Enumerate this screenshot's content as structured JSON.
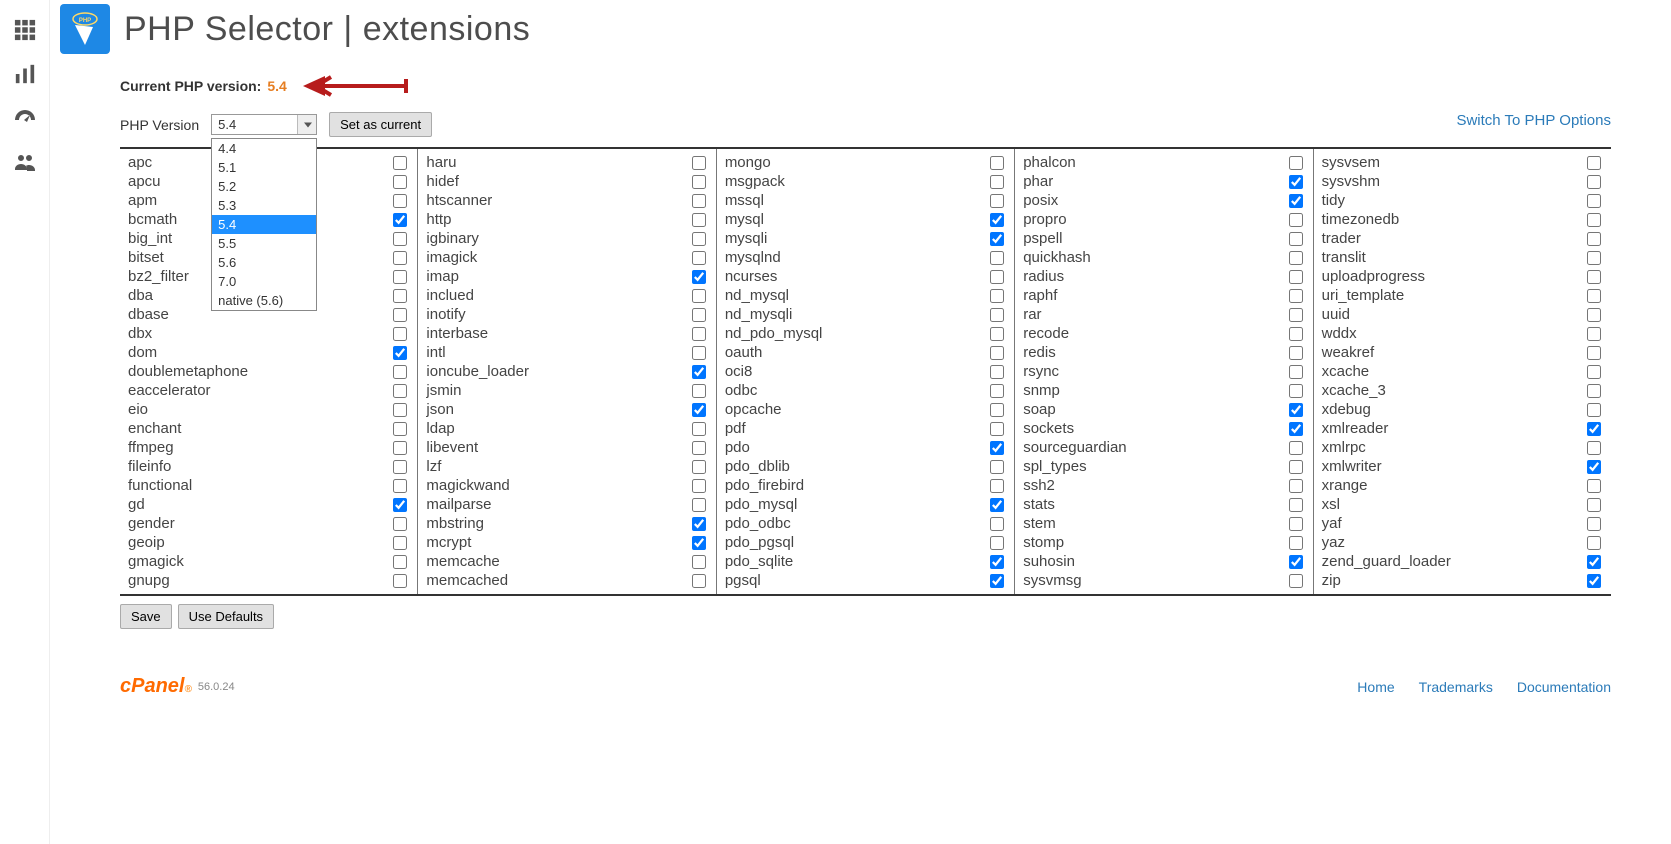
{
  "page_title": "PHP Selector | extensions",
  "current_label": "Current PHP version:",
  "current_version": "5.4",
  "version_label": "PHP Version",
  "selected_version": "5.4",
  "set_current_btn": "Set as current",
  "switch_link": "Switch To PHP Options",
  "version_options": [
    "4.4",
    "5.1",
    "5.2",
    "5.3",
    "5.4",
    "5.5",
    "5.6",
    "7.0",
    "native (5.6)"
  ],
  "save_btn": "Save",
  "defaults_btn": "Use Defaults",
  "footer": {
    "brand": "cPanel",
    "version": "56.0.24",
    "links": [
      "Home",
      "Trademarks",
      "Documentation"
    ]
  },
  "columns": [
    [
      {
        "name": "apc",
        "checked": false
      },
      {
        "name": "apcu",
        "checked": false
      },
      {
        "name": "apm",
        "checked": false
      },
      {
        "name": "bcmath",
        "checked": true
      },
      {
        "name": "big_int",
        "checked": false
      },
      {
        "name": "bitset",
        "checked": false
      },
      {
        "name": "bz2_filter",
        "checked": false
      },
      {
        "name": "dba",
        "checked": false
      },
      {
        "name": "dbase",
        "checked": false
      },
      {
        "name": "dbx",
        "checked": false
      },
      {
        "name": "dom",
        "checked": true
      },
      {
        "name": "doublemetaphone",
        "checked": false
      },
      {
        "name": "eaccelerator",
        "checked": false
      },
      {
        "name": "eio",
        "checked": false
      },
      {
        "name": "enchant",
        "checked": false
      },
      {
        "name": "ffmpeg",
        "checked": false
      },
      {
        "name": "fileinfo",
        "checked": false
      },
      {
        "name": "functional",
        "checked": false
      },
      {
        "name": "gd",
        "checked": true
      },
      {
        "name": "gender",
        "checked": false
      },
      {
        "name": "geoip",
        "checked": false
      },
      {
        "name": "gmagick",
        "checked": false
      },
      {
        "name": "gnupg",
        "checked": false
      }
    ],
    [
      {
        "name": "haru",
        "checked": false
      },
      {
        "name": "hidef",
        "checked": false
      },
      {
        "name": "htscanner",
        "checked": false
      },
      {
        "name": "http",
        "checked": false
      },
      {
        "name": "igbinary",
        "checked": false
      },
      {
        "name": "imagick",
        "checked": false
      },
      {
        "name": "imap",
        "checked": true
      },
      {
        "name": "inclued",
        "checked": false
      },
      {
        "name": "inotify",
        "checked": false
      },
      {
        "name": "interbase",
        "checked": false
      },
      {
        "name": "intl",
        "checked": false
      },
      {
        "name": "ioncube_loader",
        "checked": true
      },
      {
        "name": "jsmin",
        "checked": false
      },
      {
        "name": "json",
        "checked": true
      },
      {
        "name": "ldap",
        "checked": false
      },
      {
        "name": "libevent",
        "checked": false
      },
      {
        "name": "lzf",
        "checked": false
      },
      {
        "name": "magickwand",
        "checked": false
      },
      {
        "name": "mailparse",
        "checked": false
      },
      {
        "name": "mbstring",
        "checked": true
      },
      {
        "name": "mcrypt",
        "checked": true
      },
      {
        "name": "memcache",
        "checked": false
      },
      {
        "name": "memcached",
        "checked": false
      }
    ],
    [
      {
        "name": "mongo",
        "checked": false
      },
      {
        "name": "msgpack",
        "checked": false
      },
      {
        "name": "mssql",
        "checked": false
      },
      {
        "name": "mysql",
        "checked": true
      },
      {
        "name": "mysqli",
        "checked": true
      },
      {
        "name": "mysqlnd",
        "checked": false
      },
      {
        "name": "ncurses",
        "checked": false
      },
      {
        "name": "nd_mysql",
        "checked": false
      },
      {
        "name": "nd_mysqli",
        "checked": false
      },
      {
        "name": "nd_pdo_mysql",
        "checked": false
      },
      {
        "name": "oauth",
        "checked": false
      },
      {
        "name": "oci8",
        "checked": false
      },
      {
        "name": "odbc",
        "checked": false
      },
      {
        "name": "opcache",
        "checked": false
      },
      {
        "name": "pdf",
        "checked": false
      },
      {
        "name": "pdo",
        "checked": true
      },
      {
        "name": "pdo_dblib",
        "checked": false
      },
      {
        "name": "pdo_firebird",
        "checked": false
      },
      {
        "name": "pdo_mysql",
        "checked": true
      },
      {
        "name": "pdo_odbc",
        "checked": false
      },
      {
        "name": "pdo_pgsql",
        "checked": false
      },
      {
        "name": "pdo_sqlite",
        "checked": true
      },
      {
        "name": "pgsql",
        "checked": true
      }
    ],
    [
      {
        "name": "phalcon",
        "checked": false
      },
      {
        "name": "phar",
        "checked": true
      },
      {
        "name": "posix",
        "checked": true
      },
      {
        "name": "propro",
        "checked": false
      },
      {
        "name": "pspell",
        "checked": false
      },
      {
        "name": "quickhash",
        "checked": false
      },
      {
        "name": "radius",
        "checked": false
      },
      {
        "name": "raphf",
        "checked": false
      },
      {
        "name": "rar",
        "checked": false
      },
      {
        "name": "recode",
        "checked": false
      },
      {
        "name": "redis",
        "checked": false
      },
      {
        "name": "rsync",
        "checked": false
      },
      {
        "name": "snmp",
        "checked": false
      },
      {
        "name": "soap",
        "checked": true
      },
      {
        "name": "sockets",
        "checked": true
      },
      {
        "name": "sourceguardian",
        "checked": false
      },
      {
        "name": "spl_types",
        "checked": false
      },
      {
        "name": "ssh2",
        "checked": false
      },
      {
        "name": "stats",
        "checked": false
      },
      {
        "name": "stem",
        "checked": false
      },
      {
        "name": "stomp",
        "checked": false
      },
      {
        "name": "suhosin",
        "checked": true
      },
      {
        "name": "sysvmsg",
        "checked": false
      }
    ],
    [
      {
        "name": "sysvsem",
        "checked": false
      },
      {
        "name": "sysvshm",
        "checked": false
      },
      {
        "name": "tidy",
        "checked": false
      },
      {
        "name": "timezonedb",
        "checked": false
      },
      {
        "name": "trader",
        "checked": false
      },
      {
        "name": "translit",
        "checked": false
      },
      {
        "name": "uploadprogress",
        "checked": false
      },
      {
        "name": "uri_template",
        "checked": false
      },
      {
        "name": "uuid",
        "checked": false
      },
      {
        "name": "wddx",
        "checked": false
      },
      {
        "name": "weakref",
        "checked": false
      },
      {
        "name": "xcache",
        "checked": false
      },
      {
        "name": "xcache_3",
        "checked": false
      },
      {
        "name": "xdebug",
        "checked": false
      },
      {
        "name": "xmlreader",
        "checked": true
      },
      {
        "name": "xmlrpc",
        "checked": false
      },
      {
        "name": "xmlwriter",
        "checked": true
      },
      {
        "name": "xrange",
        "checked": false
      },
      {
        "name": "xsl",
        "checked": false
      },
      {
        "name": "yaf",
        "checked": false
      },
      {
        "name": "yaz",
        "checked": false
      },
      {
        "name": "zend_guard_loader",
        "checked": true
      },
      {
        "name": "zip",
        "checked": true
      }
    ]
  ]
}
